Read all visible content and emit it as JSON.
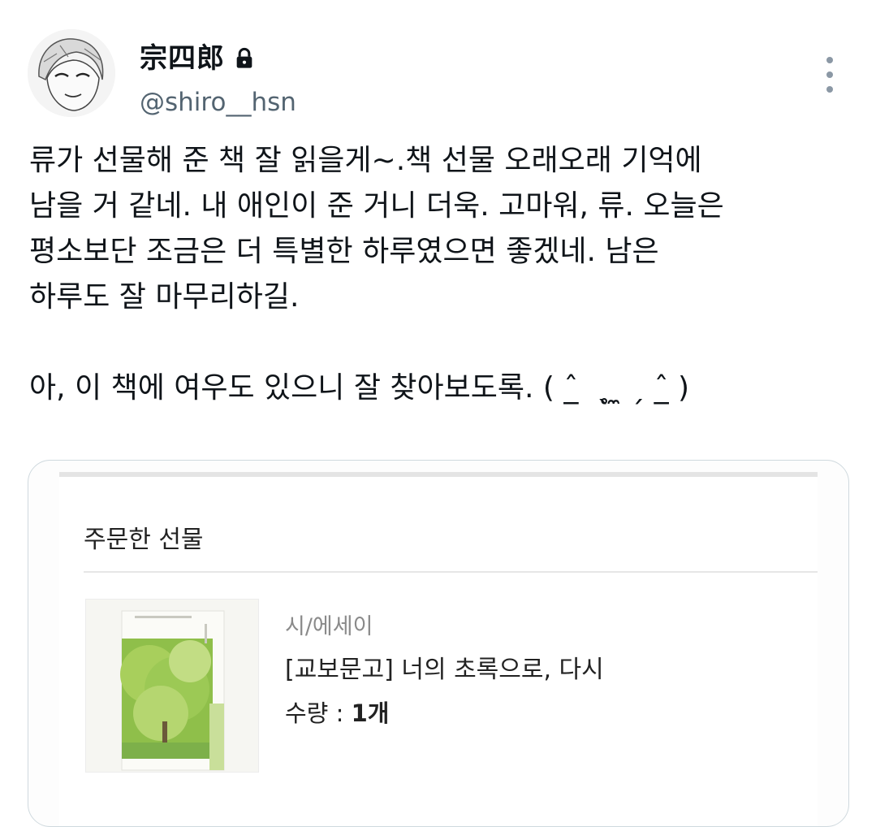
{
  "user": {
    "display_name": "宗四郎",
    "handle": "@shiro__hsn",
    "protected_icon": "lock-icon",
    "avatar_icon": "avatar-illustration"
  },
  "actions": {
    "more_icon": "more-vertical-icon"
  },
  "tweet": {
    "text": "류가 선물해 준 책 잘 읽을게~.책 선물 오래오래 기억에\n남을 거 같네. 내 애인이 준 거니 더욱. 고마워, 류. 오늘은\n평소보단 조금은 더 특별한 하루였으면 좋겠네. 남은\n하루도 잘 마무리하길.\n\n아, 이 책에 여우도 있으니 잘 찾아보도록. ( ˆ̲  ˎ̥ ̼ ˏ ˆ̲ )"
  },
  "card": {
    "section_title": "주문한 선물",
    "product": {
      "category": "시/에세이",
      "title": "[교보문고] 너의 초록으로, 다시",
      "quantity_label": "수량 : ",
      "quantity_value": "1개"
    }
  },
  "colors": {
    "text_primary": "#0f1419",
    "text_secondary": "#536471",
    "card_border": "#cfd9de"
  }
}
